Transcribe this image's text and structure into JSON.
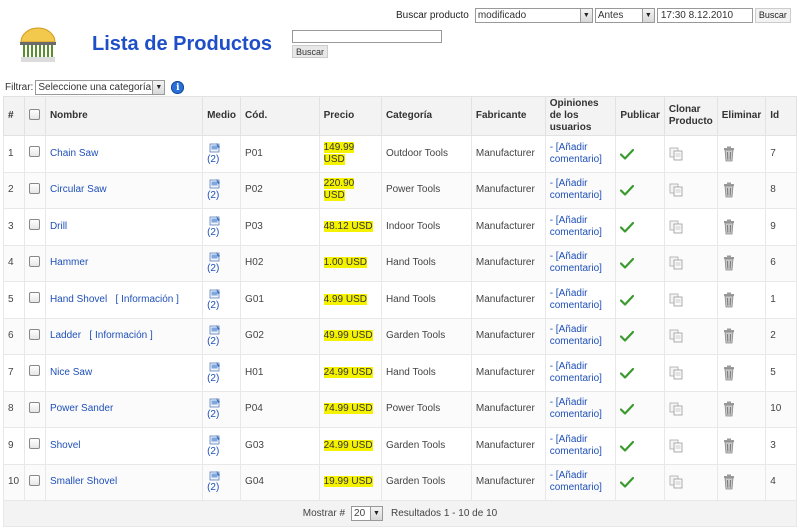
{
  "top_search": {
    "label": "Buscar producto",
    "field_value": "modificado",
    "when_value": "Antes",
    "date_value": "17:30 8.12.2010",
    "button": "Buscar"
  },
  "page_title": "Lista de Productos",
  "keyword_search": {
    "value": "",
    "button": "Buscar"
  },
  "filter": {
    "label": "Filtrar:",
    "category_value": "Seleccione una categoría"
  },
  "table": {
    "headers": {
      "num": "#",
      "name": "Nombre",
      "media": "Medio",
      "code": "Cód.",
      "price": "Precio",
      "category": "Categoría",
      "manufacturer": "Fabricante",
      "reviews": "Opiniones de los usuarios",
      "publish": "Publicar",
      "clone": "Clonar Producto",
      "delete": "Eliminar",
      "id": "Id"
    },
    "rows": [
      {
        "num": "1",
        "name": "Chain Saw",
        "info": "",
        "media_count": "(2)",
        "code": "P01",
        "price": "149.99 USD",
        "category": "Outdoor Tools",
        "manufacturer": "Manufacturer",
        "review": "- [Añadir comentario]",
        "id": "7"
      },
      {
        "num": "2",
        "name": "Circular Saw",
        "info": "",
        "media_count": "(2)",
        "code": "P02",
        "price": "220.90 USD",
        "category": "Power Tools",
        "manufacturer": "Manufacturer",
        "review": "- [Añadir comentario]",
        "id": "8"
      },
      {
        "num": "3",
        "name": "Drill",
        "info": "",
        "media_count": "(2)",
        "code": "P03",
        "price": "48.12 USD",
        "category": "Indoor Tools",
        "manufacturer": "Manufacturer",
        "review": "- [Añadir comentario]",
        "id": "9"
      },
      {
        "num": "4",
        "name": "Hammer",
        "info": "",
        "media_count": "(2)",
        "code": "H02",
        "price": "1.00 USD",
        "category": "Hand Tools",
        "manufacturer": "Manufacturer",
        "review": "- [Añadir comentario]",
        "id": "6"
      },
      {
        "num": "5",
        "name": "Hand Shovel",
        "info": "[ Información ]",
        "media_count": "(2)",
        "code": "G01",
        "price": "4.99 USD",
        "category": "Hand Tools",
        "manufacturer": "Manufacturer",
        "review": "- [Añadir comentario]",
        "id": "1"
      },
      {
        "num": "6",
        "name": "Ladder",
        "info": "[ Información ]",
        "media_count": "(2)",
        "code": "G02",
        "price": "49.99 USD",
        "category": "Garden Tools",
        "manufacturer": "Manufacturer",
        "review": "- [Añadir comentario]",
        "id": "2"
      },
      {
        "num": "7",
        "name": "Nice Saw",
        "info": "",
        "media_count": "(2)",
        "code": "H01",
        "price": "24.99 USD",
        "category": "Hand Tools",
        "manufacturer": "Manufacturer",
        "review": "- [Añadir comentario]",
        "id": "5"
      },
      {
        "num": "8",
        "name": "Power Sander",
        "info": "",
        "media_count": "(2)",
        "code": "P04",
        "price": "74.99 USD",
        "category": "Power Tools",
        "manufacturer": "Manufacturer",
        "review": "- [Añadir comentario]",
        "id": "10"
      },
      {
        "num": "9",
        "name": "Shovel",
        "info": "",
        "media_count": "(2)",
        "code": "G03",
        "price": "24.99 USD",
        "category": "Garden Tools",
        "manufacturer": "Manufacturer",
        "review": "- [Añadir comentario]",
        "id": "3"
      },
      {
        "num": "10",
        "name": "Smaller Shovel",
        "info": "",
        "media_count": "(2)",
        "code": "G04",
        "price": "19.99 USD",
        "category": "Garden Tools",
        "manufacturer": "Manufacturer",
        "review": "- [Añadir comentario]",
        "id": "4"
      }
    ]
  },
  "footer": {
    "show_label": "Mostrar #",
    "per_page": "20",
    "results": "Resultados 1 - 10 de 10"
  },
  "colors": {
    "title": "#1f4fc8",
    "link": "#1f50b8",
    "price_highlight": "#f5f200",
    "publish_check": "#3b9a2e"
  },
  "icons": {
    "media": "media-icon",
    "publish": "check-icon",
    "clone": "clone-icon",
    "delete": "trash-icon",
    "help": "info-icon"
  }
}
